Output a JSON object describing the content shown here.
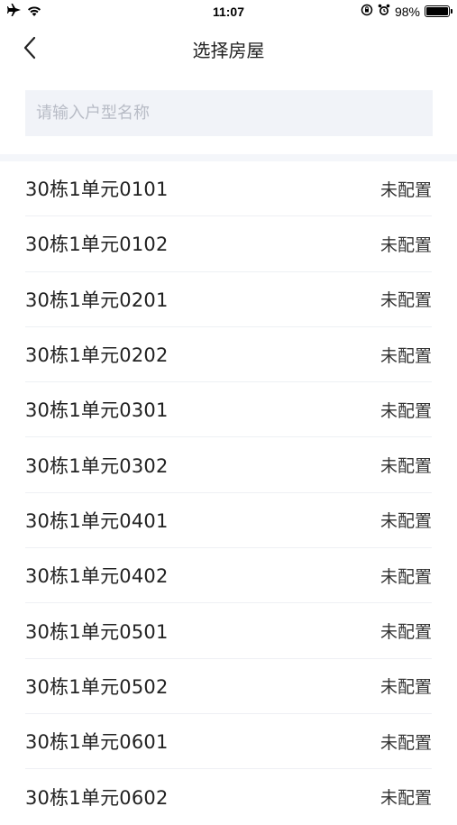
{
  "status_bar": {
    "time": "11:07",
    "battery": "98%",
    "battery_level": 0.98
  },
  "header": {
    "title": "选择房屋"
  },
  "search": {
    "placeholder": "请输入户型名称",
    "value": ""
  },
  "rooms": [
    {
      "name": "30栋1单元0101",
      "status": "未配置"
    },
    {
      "name": "30栋1单元0102",
      "status": "未配置"
    },
    {
      "name": "30栋1单元0201",
      "status": "未配置"
    },
    {
      "name": "30栋1单元0202",
      "status": "未配置"
    },
    {
      "name": "30栋1单元0301",
      "status": "未配置"
    },
    {
      "name": "30栋1单元0302",
      "status": "未配置"
    },
    {
      "name": "30栋1单元0401",
      "status": "未配置"
    },
    {
      "name": "30栋1单元0402",
      "status": "未配置"
    },
    {
      "name": "30栋1单元0501",
      "status": "未配置"
    },
    {
      "name": "30栋1单元0502",
      "status": "未配置"
    },
    {
      "name": "30栋1单元0601",
      "status": "未配置"
    },
    {
      "name": "30栋1单元0602",
      "status": "未配置"
    }
  ]
}
